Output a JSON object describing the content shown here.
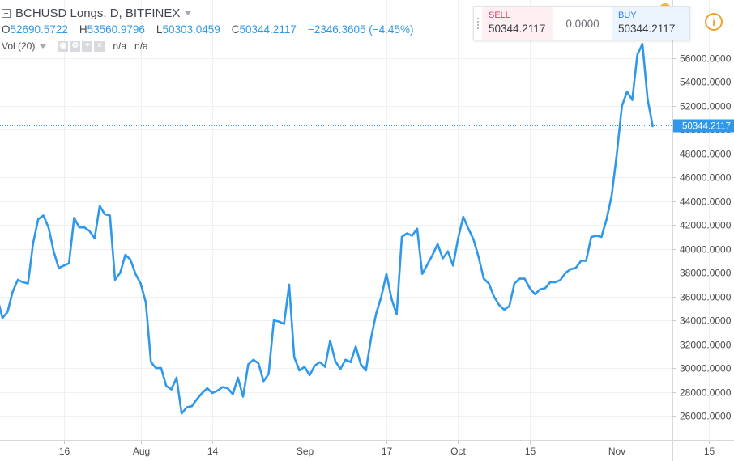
{
  "header": {
    "symbol_title": "BCHUSD Longs, D, BITFINEX"
  },
  "ohlc": {
    "o_label": "O",
    "o_value": "52690.5722",
    "h_label": "H",
    "h_value": "53560.9796",
    "l_label": "L",
    "l_value": "50303.0459",
    "c_label": "C",
    "c_value": "50344.2117",
    "change": "−2346.3605 (−4.45%)"
  },
  "volume": {
    "label": "Vol (20)",
    "value_1": "n/a",
    "value_2": "n/a"
  },
  "trade": {
    "sell_label": "SELL",
    "sell_price": "50344.2117",
    "spread": "0.0000",
    "buy_label": "BUY",
    "buy_price": "50344.2117"
  },
  "info_icon_text": "i",
  "colors": {
    "line": "#3098ea",
    "price_tag": "#3098ea",
    "sell": "#e0395a",
    "buy": "#2f7fe8",
    "grid": "#eef0f3"
  },
  "chart_data": {
    "type": "line",
    "last_price_label": "50344.2117",
    "last_price": 50344.2117,
    "y_range": [
      25000,
      58500
    ],
    "y_ticks": [
      26000,
      28000,
      30000,
      32000,
      34000,
      36000,
      38000,
      40000,
      42000,
      44000,
      46000,
      48000,
      50000,
      52000,
      54000,
      56000
    ],
    "y_tick_labels": [
      "26000.0000",
      "28000.0000",
      "30000.0000",
      "32000.0000",
      "34000.0000",
      "36000.0000",
      "38000.0000",
      "40000.0000",
      "42000.0000",
      "44000.0000",
      "46000.0000",
      "48000.0000",
      "50000.0000",
      "52000.0000",
      "54000.0000",
      "56000.0000"
    ],
    "x_range": [
      0,
      126
    ],
    "x_ticks": [
      {
        "x": 12,
        "label": "16"
      },
      {
        "x": 27,
        "label": "Aug"
      },
      {
        "x": 41,
        "label": "14"
      },
      {
        "x": 59,
        "label": "Sep"
      },
      {
        "x": 75,
        "label": "17"
      },
      {
        "x": 89,
        "label": "Oct"
      },
      {
        "x": 103,
        "label": "15"
      },
      {
        "x": 120,
        "label": "Nov"
      },
      {
        "x": 138,
        "label": "15"
      }
    ],
    "series": [
      {
        "values": [
          37000,
          32700,
          33700,
          35000,
          36000,
          35900,
          34200,
          34700,
          36400,
          37400,
          37200,
          37100,
          40500,
          42500,
          42800,
          41800,
          39800,
          38400,
          38600,
          38800,
          42600,
          41800,
          41800,
          41500,
          40900,
          43600,
          42900,
          42800,
          37400,
          38000,
          39500,
          39100,
          37900,
          37100,
          35500,
          30500,
          30000,
          30000,
          28500,
          28200,
          29200,
          26200,
          26700,
          26800,
          27400,
          27900,
          28300,
          27900,
          28100,
          28400,
          28300,
          27800,
          29200,
          27600,
          30300,
          30700,
          30400,
          28900,
          29500,
          34000,
          33900,
          33700,
          37000,
          30900,
          29800,
          30100,
          29400,
          30200,
          30500,
          30100,
          32300,
          30600,
          29900,
          30700,
          30500,
          31800,
          30300,
          29800,
          32500,
          34600,
          36000,
          37900,
          35800,
          34500,
          41000,
          41300,
          41100,
          41700,
          37900,
          38700,
          39500,
          40400,
          39200,
          39800,
          38600,
          40900,
          42700,
          41700,
          40800,
          39300,
          37500,
          37100,
          36000,
          35300,
          34900,
          35200,
          37100,
          37500,
          37500,
          36700,
          36200,
          36600,
          36700,
          37200,
          37200,
          37400,
          38000,
          38300,
          38400,
          39000,
          39000,
          41000,
          41100,
          41000,
          42500,
          44500,
          48000,
          52000,
          53200,
          52500,
          56300,
          57200,
          52600,
          50300
        ],
        "x_start": -6
      }
    ]
  }
}
